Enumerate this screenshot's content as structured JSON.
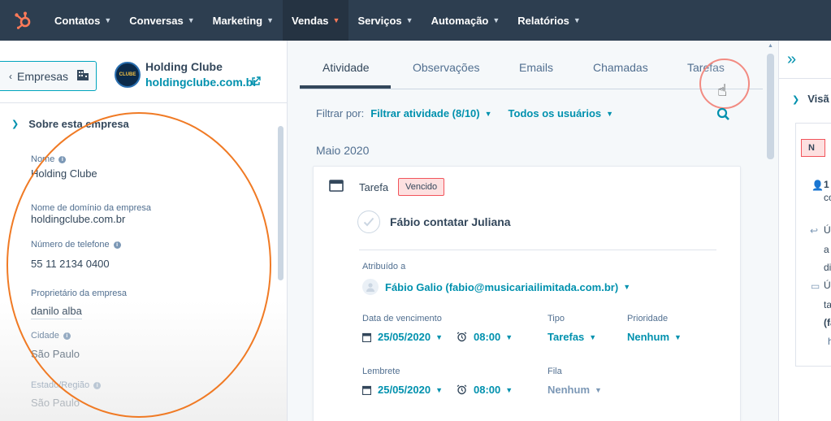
{
  "nav": {
    "items": [
      {
        "label": "Contatos"
      },
      {
        "label": "Conversas"
      },
      {
        "label": "Marketing"
      },
      {
        "label": "Vendas"
      },
      {
        "label": "Serviços"
      },
      {
        "label": "Automação"
      },
      {
        "label": "Relatórios"
      }
    ],
    "active": "Vendas",
    "accent": "#ff7a59"
  },
  "left": {
    "back_label": "Empresas",
    "company_name": "Holding Clube",
    "company_domain": "holdingclube.com.br",
    "logo_text": "CLUBE",
    "section_title": "Sobre esta empresa",
    "properties": [
      {
        "label": "Nome",
        "value": "Holding Clube"
      },
      {
        "label": "Nome de domínio da empresa",
        "value": "holdingclube.com.br"
      },
      {
        "label": "Número de telefone",
        "value": "55 11 2134 0400"
      },
      {
        "label": "Proprietário da empresa",
        "value": "danilo alba"
      },
      {
        "label": "Cidade",
        "value": "São Paulo"
      },
      {
        "label": "Estado/Região",
        "value": "São Paulo"
      }
    ]
  },
  "tabs": [
    {
      "label": "Atividade"
    },
    {
      "label": "Observações"
    },
    {
      "label": "Emails"
    },
    {
      "label": "Chamadas"
    },
    {
      "label": "Tarefas"
    }
  ],
  "filter": {
    "label": "Filtrar por:",
    "activity": "Filtrar atividade (8/10)",
    "users": "Todos os usuários"
  },
  "month": "Maio 2020",
  "task": {
    "type_label": "Tarefa",
    "status": "Vencido",
    "title": "Fábio contatar Juliana",
    "assigned_label": "Atribuído a",
    "assigned_value": "Fábio Galio (fabio@musicariailimitada.com.br)",
    "due_label": "Data de vencimento",
    "due_date": "25/05/2020",
    "due_time": "08:00",
    "type_field_label": "Tipo",
    "type_value": "Tarefas",
    "priority_label": "Prioridade",
    "priority_value": "Nenhum",
    "reminder_label": "Lembrete",
    "reminder_date": "25/05/2020",
    "reminder_time": "08:00",
    "queue_label": "Fila",
    "queue_value": "Nenhum"
  },
  "right": {
    "section": "Visã",
    "badge": "N",
    "lines": [
      "1",
      "co",
      "Ú",
      "a",
      "di",
      "Ú",
      "ta",
      "(fa",
      "h"
    ]
  }
}
